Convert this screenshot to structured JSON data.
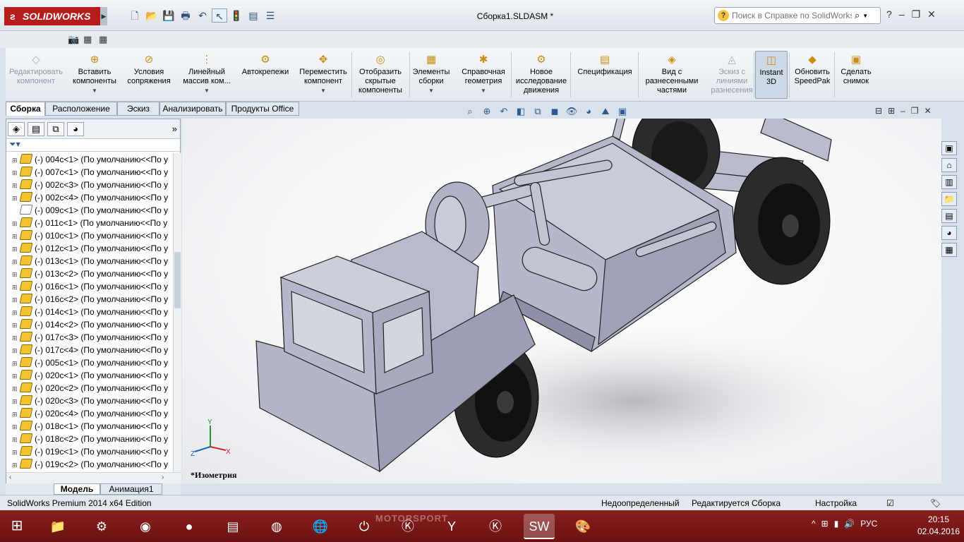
{
  "app": {
    "logo": "SOLIDWORKS",
    "document_title": "Сборка1.SLDASM *"
  },
  "quick_access": [
    {
      "name": "new-icon",
      "glyph": "🗋"
    },
    {
      "name": "open-icon",
      "glyph": "📂"
    },
    {
      "name": "save-icon",
      "glyph": "💾"
    },
    {
      "name": "print-icon",
      "glyph": "🖶"
    },
    {
      "name": "undo-icon",
      "glyph": "↶"
    },
    {
      "name": "select-icon",
      "glyph": "↖"
    },
    {
      "name": "rebuild-icon",
      "glyph": "🚦"
    },
    {
      "name": "file-properties-icon",
      "glyph": "▤"
    },
    {
      "name": "options-icon",
      "glyph": "☰"
    }
  ],
  "search": {
    "placeholder": "Поиск в Справке по SolidWorks"
  },
  "ribbon": [
    {
      "name": "edit-component",
      "label": "Редактировать компонент",
      "disabled": true
    },
    {
      "name": "insert-components",
      "label": "Вставить компоненты",
      "dropdown": true
    },
    {
      "name": "mate",
      "label": "Условия сопряжения"
    },
    {
      "name": "linear-pattern",
      "label": "Линейный массив ком...",
      "dropdown": true
    },
    {
      "name": "smart-fasteners",
      "label": "Автокрепежи"
    },
    {
      "name": "move-component",
      "label": "Переместить компонент",
      "dropdown": true
    },
    {
      "name": "show-hidden",
      "label": "Отобразить скрытые компоненты"
    },
    {
      "name": "assembly-features",
      "label": "Элементы сборки",
      "dropdown": true
    },
    {
      "name": "reference-geometry",
      "label": "Справочная геометрия",
      "dropdown": true
    },
    {
      "name": "new-motion-study",
      "label": "Новое исследование движения"
    },
    {
      "name": "bill-of-materials",
      "label": "Спецификация"
    },
    {
      "name": "exploded-view",
      "label": "Вид с разнесенными частями"
    },
    {
      "name": "explode-line-sketch",
      "label": "Эскиз с линиями разнесения",
      "disabled": true
    },
    {
      "name": "instant-3d",
      "label": "Instant 3D",
      "active": true
    },
    {
      "name": "update-speedpak",
      "label": "Обновить SpeedPak"
    },
    {
      "name": "take-snapshot",
      "label": "Сделать снимок"
    }
  ],
  "command_tabs": [
    "Сборка",
    "Расположение",
    "Эскиз",
    "Анализировать",
    "Продукты Office"
  ],
  "tree": [
    {
      "label": "(-) 004c<1> (По умолчанию<<По у"
    },
    {
      "label": "(-) 007c<1> (По умолчанию<<По у"
    },
    {
      "label": "(-) 002c<3> (По умолчанию<<По у"
    },
    {
      "label": "(-) 002c<4> (По умолчанию<<По у"
    },
    {
      "label": "(-) 009c<1> (По умолчанию<<По у",
      "hidden": true
    },
    {
      "label": "(-) 011c<1> (По умолчанию<<По у"
    },
    {
      "label": "(-) 010c<1> (По умолчанию<<По у"
    },
    {
      "label": "(-) 012c<1> (По умолчанию<<По у"
    },
    {
      "label": "(-) 013c<1> (По умолчанию<<По у"
    },
    {
      "label": "(-) 013c<2> (По умолчанию<<По у"
    },
    {
      "label": "(-) 016c<1> (По умолчанию<<По у"
    },
    {
      "label": "(-) 016c<2> (По умолчанию<<По у"
    },
    {
      "label": "(-) 014c<1> (По умолчанию<<По у"
    },
    {
      "label": "(-) 014c<2> (По умолчанию<<По у"
    },
    {
      "label": "(-) 017c<3> (По умолчанию<<По у"
    },
    {
      "label": "(-) 017c<4> (По умолчанию<<По у"
    },
    {
      "label": "(-) 005c<1> (По умолчанию<<По у"
    },
    {
      "label": "(-) 020c<1> (По умолчанию<<По у"
    },
    {
      "label": "(-) 020c<2> (По умолчанию<<По у"
    },
    {
      "label": "(-) 020c<3> (По умолчанию<<По у"
    },
    {
      "label": "(-) 020c<4> (По умолчанию<<По у"
    },
    {
      "label": "(-) 018c<1> (По умолчанию<<По у"
    },
    {
      "label": "(-) 018c<2> (По умолчанию<<По у"
    },
    {
      "label": "(-) 019c<1> (По умолчанию<<По у"
    },
    {
      "label": "(-) 019c<2> (По умолчанию<<По у"
    }
  ],
  "bottom_tabs": [
    "Модель",
    "Анимация1"
  ],
  "viewport": {
    "view_label": "*Изометрия",
    "triad": {
      "x": "X",
      "y": "Y",
      "z": "Z"
    }
  },
  "status": {
    "edition": "SolidWorks Premium 2014 x64 Edition",
    "definition": "Недоопределенный",
    "editing": "Редактируется Сборка",
    "custom": "Настройка"
  },
  "taskbar": {
    "watermark": "MOTORSPORT",
    "lang": "РУС",
    "time": "20:15",
    "date": "02.04.2016"
  },
  "colors": {
    "brand": "#b71c1c",
    "taskbar": "#7a1818",
    "model": "#b3b6c9"
  }
}
